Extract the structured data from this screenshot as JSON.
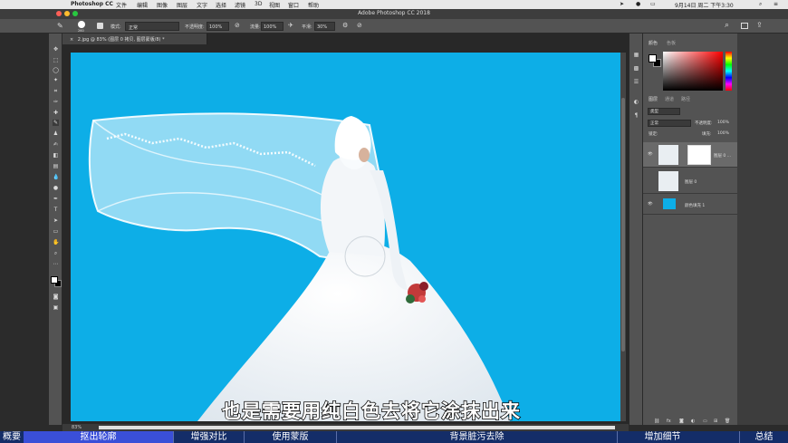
{
  "menubar": {
    "app": "Photoshop CC",
    "items": [
      "文件",
      "编辑",
      "图像",
      "图层",
      "文字",
      "选择",
      "滤镜",
      "3D",
      "视图",
      "窗口",
      "帮助"
    ],
    "datetime": "9月14日 周二 下午3:30"
  },
  "window": {
    "title": "Adobe Photoshop CC 2018"
  },
  "options": {
    "brush_size": "260",
    "mode_label": "模式:",
    "mode_value": "正常",
    "opacity_label": "不透明度:",
    "opacity_value": "100%",
    "flow_label": "流量:",
    "flow_value": "100%",
    "smooth_label": "平滑:",
    "smooth_value": "30%"
  },
  "document": {
    "tab": "2.jpg @ 83% (图层 0 拷贝, 图层蒙版/8) *",
    "zoom": "83%"
  },
  "panels": {
    "color_tabs": [
      "颜色",
      "色板"
    ],
    "layer_tabs": [
      "图层",
      "通道",
      "路径"
    ],
    "filter_kind": "类型",
    "blend_mode": "正常",
    "opacity_label": "不透明度:",
    "opacity_value": "100%",
    "lock_label": "锁定:",
    "fill_label": "填充:",
    "fill_value": "100%",
    "layers": [
      {
        "name": "图层 0 ..."
      },
      {
        "name": "图层 0"
      },
      {
        "name": "颜色填充 1"
      }
    ]
  },
  "subtitle": "也是需要用纯白色去将它涂抹出来",
  "chapters": [
    "概要",
    "抠出轮廓",
    "增强对比",
    "使用蒙版",
    "背景脏污去除",
    "增加细节",
    "总结"
  ],
  "colors": {
    "canvas_bg": "#0daee7",
    "chapter_bar": "#142d68",
    "chapter_active": "#3a4fd8"
  }
}
